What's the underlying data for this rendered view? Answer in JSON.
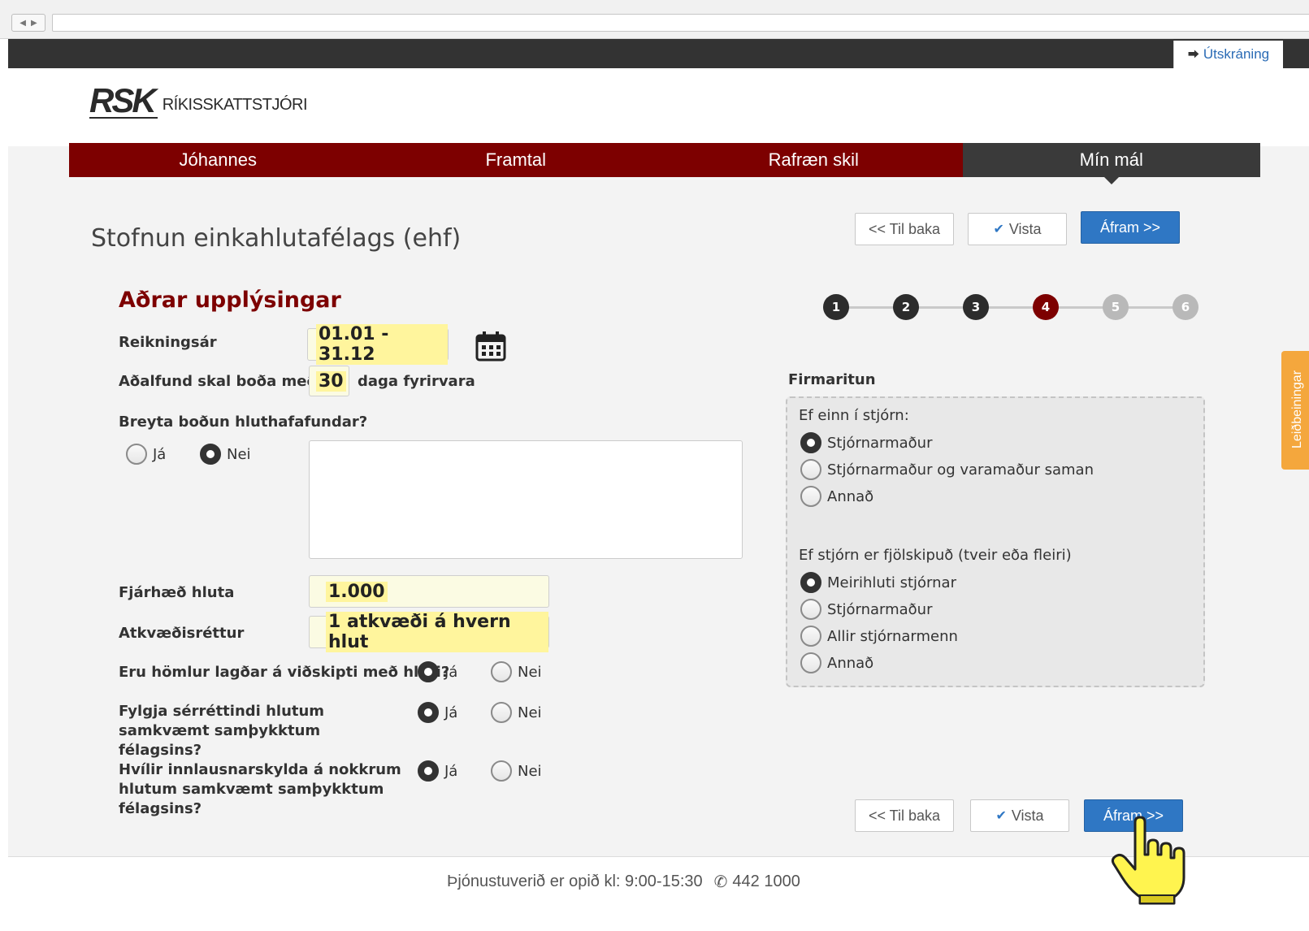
{
  "header": {
    "logout_label": "Útskráning",
    "logo_mark": "RSK",
    "logo_name": "RÍKISSKATTSTJÓRI"
  },
  "nav": {
    "tabs": [
      {
        "label": "Jóhannes"
      },
      {
        "label": "Framtal"
      },
      {
        "label": "Rafræn skil"
      },
      {
        "label": "Mín mál"
      }
    ]
  },
  "page": {
    "title": "Stofnun einkahlutafélags (ehf)",
    "section_title": "Aðrar upplýsingar"
  },
  "buttons": {
    "back": "<< Til baka",
    "save": "Vista",
    "next": "Áfram >>"
  },
  "steps": [
    "1",
    "2",
    "3",
    "4",
    "5",
    "6"
  ],
  "form": {
    "fiscal_year_label": "Reikningsár",
    "fiscal_year_value": "01.01 - 31.12",
    "meeting_notice_label": "Aðalfund skal boða með",
    "meeting_notice_value": "30",
    "meeting_notice_suffix": "daga fyrirvara",
    "change_notice_label": "Breyta boðun hluthafafundar?",
    "yes": "Já",
    "no": "Nei",
    "share_amount_label": "Fjárhæð hluta",
    "share_amount_value": "1.000",
    "voting_label": "Atkvæðisréttur",
    "voting_value": "1 atkvæði á hvern hlut",
    "restrictions_label": "Eru hömlur lagðar á viðskipti með hluti?",
    "privileges_label": "Fylgja sérréttindi hlutum samkvæmt samþykktum félagsins?",
    "redemption_label": "Hvílir innlausnarskylda á nokkrum hlutum samkvæmt samþykktum félagsins?"
  },
  "firmaritun": {
    "label": "Firmaritun",
    "single_heading": "Ef einn í stjórn:",
    "single_options": [
      "Stjórnarmaður",
      "Stjórnarmaður og varamaður saman",
      "Annað"
    ],
    "multi_heading": "Ef stjórn er fjölskipuð (tveir eða fleiri)",
    "multi_options": [
      "Meirihluti stjórnar",
      "Stjórnarmaður",
      "Allir stjórnarmenn",
      "Annað"
    ]
  },
  "side_tab": "Leiðbeiningar",
  "footer": {
    "hours": "Þjónustuverið er opið kl: 9:00-15:30",
    "phone": "442 1000"
  }
}
